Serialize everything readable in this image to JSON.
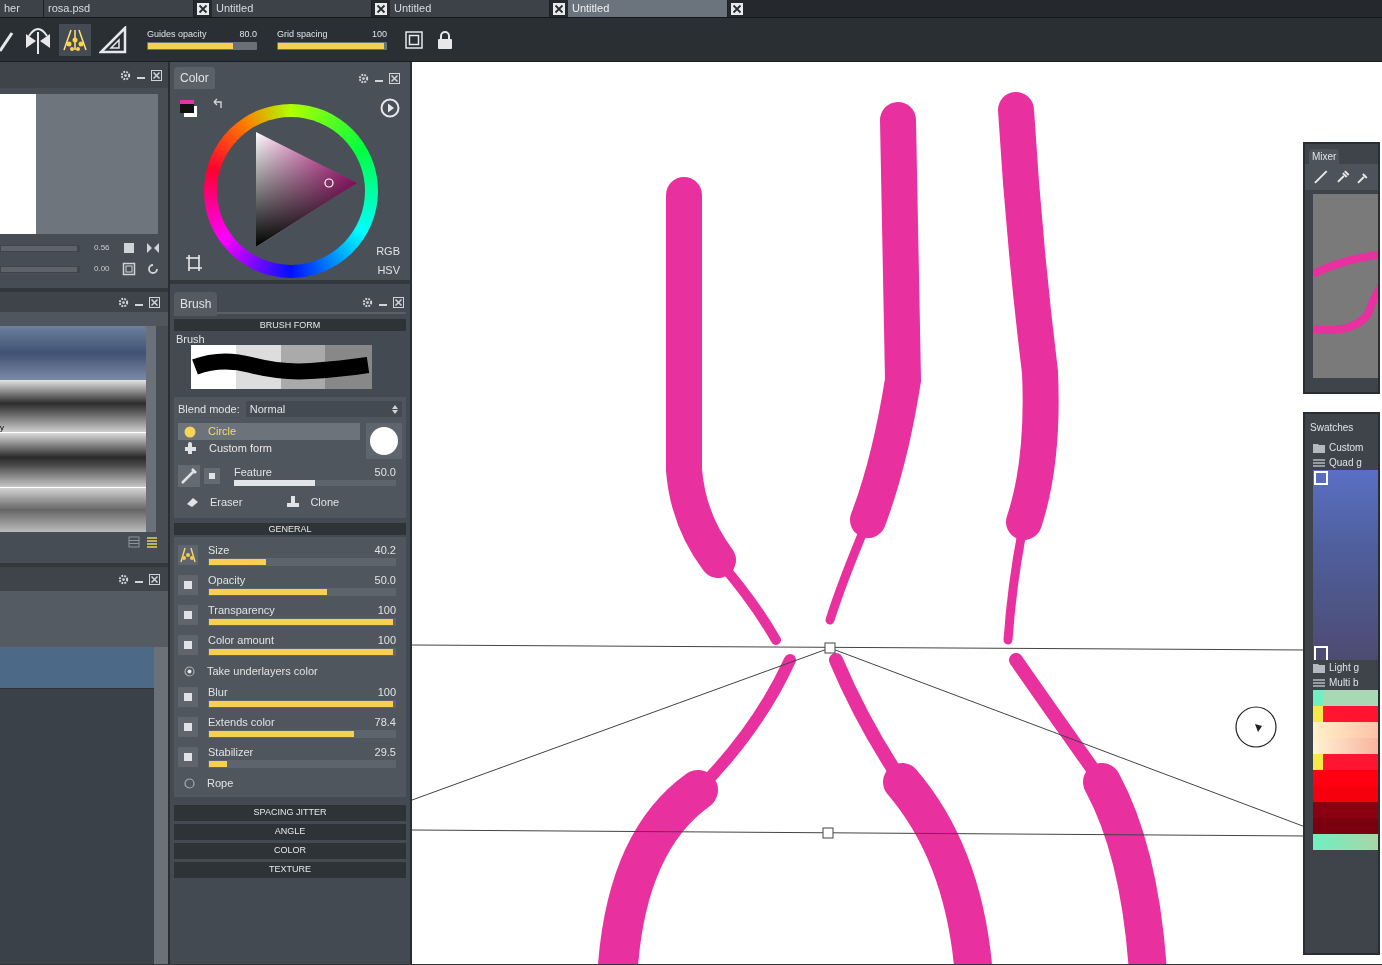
{
  "tabs": [
    {
      "label": "her",
      "closable": false,
      "selected": false
    },
    {
      "label": "rosa.psd",
      "closable": true,
      "selected": false
    },
    {
      "label": "Untitled",
      "closable": true,
      "selected": false
    },
    {
      "label": "Untitled",
      "closable": true,
      "selected": false
    },
    {
      "label": "Untitled",
      "closable": true,
      "selected": true
    }
  ],
  "toolbar": {
    "sliders": [
      {
        "label": "Guides opacity",
        "value": "80.0",
        "level": 0.8
      },
      {
        "label": "Grid spacing",
        "value": "100",
        "level": 1
      }
    ]
  },
  "navigator": {
    "sliders": [
      {
        "value": "0.56",
        "level": 1
      },
      {
        "value": "0.00",
        "level": 1
      }
    ]
  },
  "presets": {
    "caption": "y"
  },
  "layers": {
    "rows": [
      {
        "selected": true
      }
    ]
  },
  "color_panel": {
    "title": "Color",
    "modes": [
      "RGB",
      "HSV"
    ]
  },
  "brush_panel": {
    "title": "Brush",
    "form_section": {
      "title": "BRUSH FORM",
      "label": "Brush",
      "blend_label": "Blend mode:",
      "blend_value": "Normal",
      "forms": [
        {
          "label": "Circle",
          "selected": true
        },
        {
          "label": "Custom form",
          "selected": false
        }
      ],
      "feature": {
        "label": "Feature",
        "value": "50.0",
        "level": 0.5
      },
      "tools": [
        "Eraser",
        "Clone"
      ]
    },
    "general_section": {
      "title": "GENERAL",
      "params": [
        {
          "kind": "tool-slider",
          "label": "Size",
          "value": "40.2",
          "level": 0.31
        },
        {
          "kind": "slider",
          "label": "Opacity",
          "value": "50.0",
          "level": 0.64
        },
        {
          "kind": "slider",
          "label": "Transparency",
          "value": "100",
          "level": 1
        },
        {
          "kind": "slider",
          "label": "Color amount",
          "value": "100",
          "level": 1
        },
        {
          "kind": "radio",
          "label": "Take underlayers color",
          "checked": true
        },
        {
          "kind": "slider",
          "label": "Blur",
          "value": "100",
          "level": 1
        },
        {
          "kind": "slider",
          "label": "Extends color",
          "value": "78.4",
          "level": 0.79
        },
        {
          "kind": "slider",
          "label": "Stabilizer",
          "value": "29.5",
          "level": 0.1
        },
        {
          "kind": "radio",
          "label": "Rope",
          "checked": false
        }
      ]
    },
    "collapsed_sections": [
      "SPACING JITTER",
      "ANGLE",
      "COLOR",
      "TEXTURE"
    ]
  },
  "mixer": {
    "title": "Mixer"
  },
  "swatches": {
    "title": "Swatches",
    "sections": [
      {
        "groups": [
          {
            "label": "Custom"
          },
          {
            "label": "Quad g"
          }
        ]
      },
      {
        "groups": [
          {
            "label": "Light g"
          },
          {
            "label": "Multi b"
          }
        ]
      }
    ]
  }
}
